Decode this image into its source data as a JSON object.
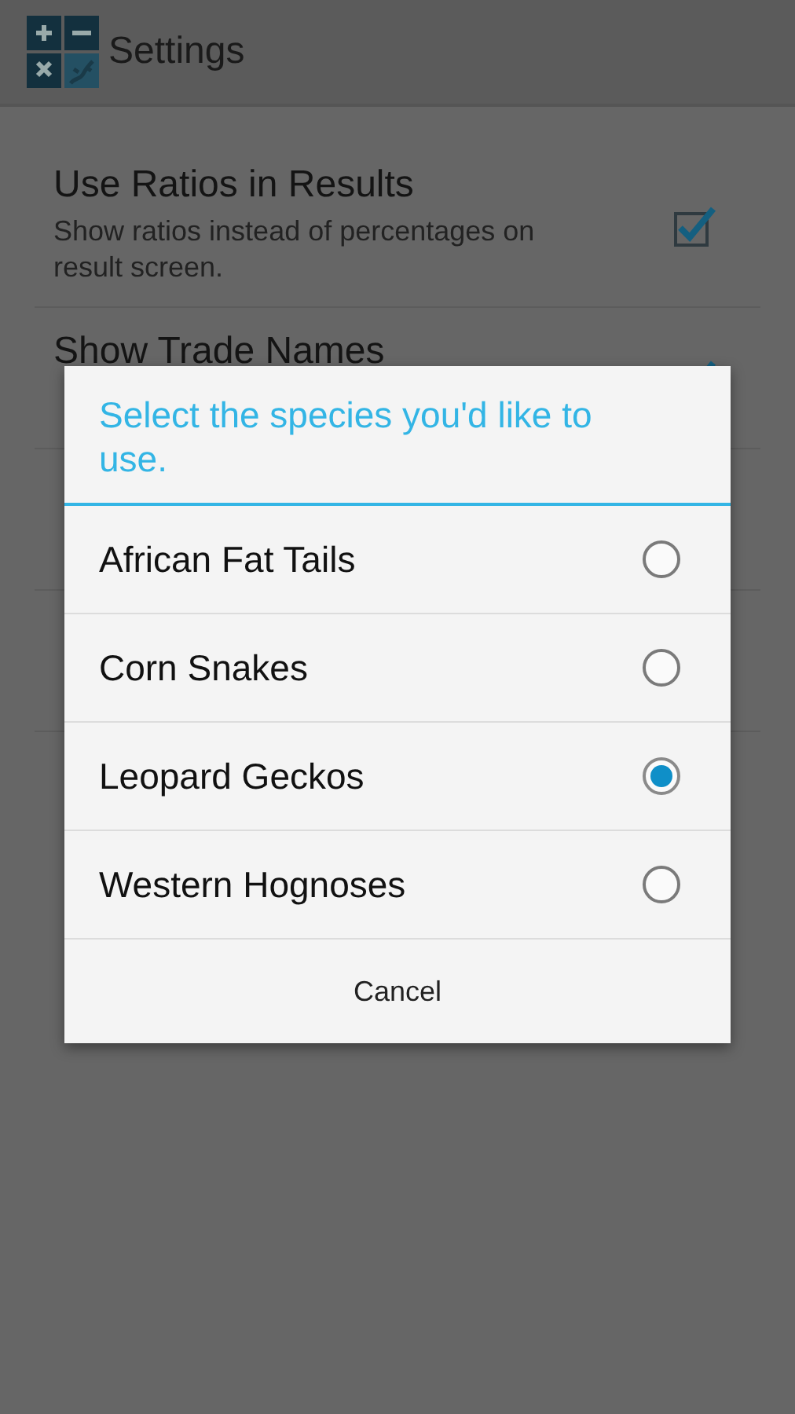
{
  "app_bar": {
    "title": "Settings"
  },
  "settings": [
    {
      "title": "Use Ratios in Results",
      "subtitle": "Show ratios instead of percentages on result screen.",
      "checked": true
    },
    {
      "title": "Show Trade Names",
      "checked": true
    }
  ],
  "dialog": {
    "title": "Select the species you'd like to use.",
    "options": [
      {
        "label": "African Fat Tails",
        "selected": false
      },
      {
        "label": "Corn Snakes",
        "selected": false
      },
      {
        "label": "Leopard Geckos",
        "selected": true
      },
      {
        "label": "Western Hognoses",
        "selected": false
      }
    ],
    "button": "Cancel"
  }
}
